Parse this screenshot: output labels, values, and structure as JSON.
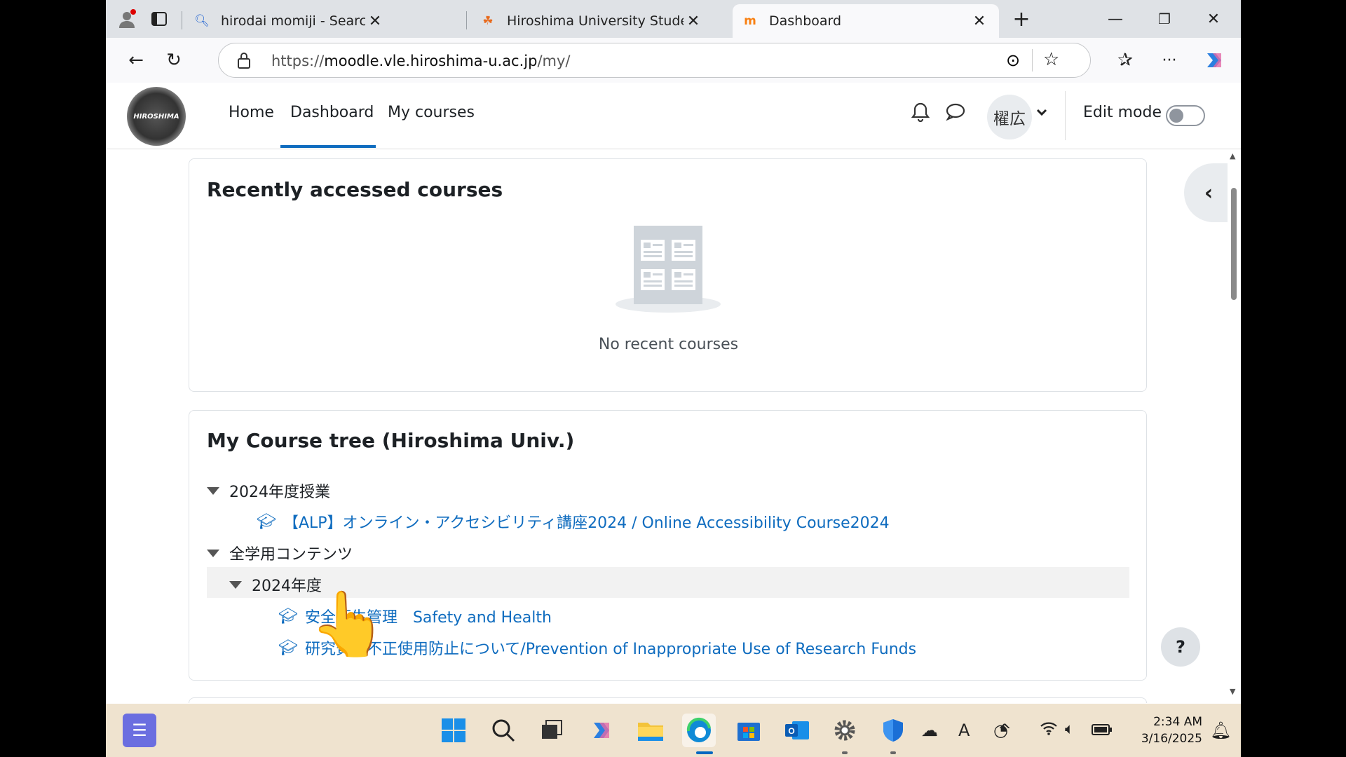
{
  "browser": {
    "tabs": [
      {
        "title": "hirodai momiji - Search",
        "icon": "search-icon"
      },
      {
        "title": "Hiroshima University Student Info",
        "icon": "maple-leaf-icon"
      },
      {
        "title": "Dashboard",
        "icon": "moodle-icon",
        "active": true
      }
    ],
    "url_prefix": "https://",
    "url_host": "moodle.vle.hiroshima-u.ac.jp",
    "url_path": "/my/"
  },
  "moodle": {
    "logo_text": "HIROSHIMA",
    "nav": [
      "Home",
      "Dashboard",
      "My courses"
    ],
    "active_nav": "Dashboard",
    "user_name": "櫂広",
    "edit_mode_label": "Edit mode",
    "edit_mode_on": false
  },
  "recent": {
    "title": "Recently accessed courses",
    "empty_text": "No recent courses"
  },
  "tree": {
    "title": "My Course tree (Hiroshima Univ.)",
    "groups": [
      {
        "label": "2024年度授業",
        "courses": [
          "【ALP】オンライン・アクセシビリティ講座2024 / Online Accessibility Course2024"
        ]
      },
      {
        "label": "全学用コンテンツ",
        "subgroup": "2024年度",
        "courses": [
          "安全衛生管理　Safety and Health",
          "研究費等不正使用防止について/Prevention of Inappropriate Use of Research Funds"
        ]
      }
    ]
  },
  "help": "?",
  "taskbar": {
    "time": "2:34 AM",
    "date": "3/16/2025"
  }
}
